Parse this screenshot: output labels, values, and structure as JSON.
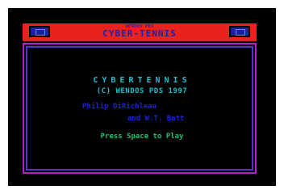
{
  "window": {
    "caption_small": "WENDOS PDS",
    "title": "CYBER-TENNIS"
  },
  "splash": {
    "game_title": "CYBERTENNIS",
    "copyright": "(C) WENDOS PDS 1997",
    "credit_line_1": "Philip DiRichleau",
    "credit_line_2": "and W.T. Batt",
    "prompt": "Press Space to Play"
  },
  "colors": {
    "titlebar": "#e8231f",
    "title_text": "#1d1fa8",
    "frame_outer": "#b020c8",
    "frame_inner": "#5a2fd0",
    "cyan_text": "#1fbfcf",
    "blue_text": "#1d22d8",
    "green_text": "#1fbf6a"
  }
}
